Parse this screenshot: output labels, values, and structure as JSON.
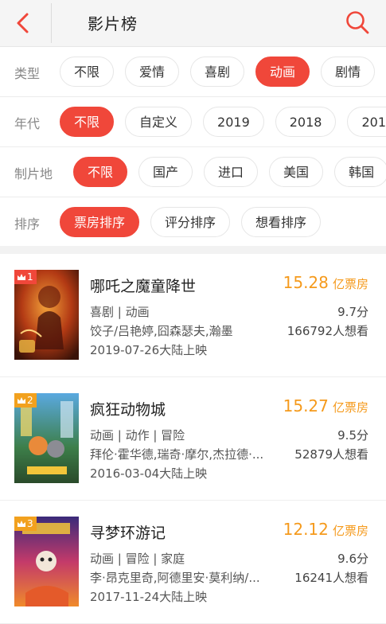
{
  "header": {
    "title": "影片榜",
    "back_icon": "chevron-left-icon",
    "search_icon": "search-icon",
    "accent_color": "#f0473a"
  },
  "filters": [
    {
      "label": "类型",
      "options": [
        "不限",
        "爱情",
        "喜剧",
        "动画",
        "剧情"
      ],
      "selected": "动画"
    },
    {
      "label": "年代",
      "options": [
        "不限",
        "自定义",
        "2019",
        "2018",
        "201"
      ],
      "selected": "不限"
    },
    {
      "label": "制片地",
      "options": [
        "不限",
        "国产",
        "进口",
        "美国",
        "韩国"
      ],
      "selected": "不限"
    },
    {
      "label": "排序",
      "options": [
        "票房排序",
        "评分排序",
        "想看排序"
      ],
      "selected": "票房排序"
    }
  ],
  "movies": [
    {
      "rank": "1",
      "title": "哪吒之魔童降世",
      "genre": "喜剧 | 动画",
      "cast": "饺子/吕艳婷,囧森瑟夫,瀚墨",
      "date": "2019-07-26大陆上映",
      "box_office": "15.28",
      "box_unit": "亿票房",
      "score": "9.7分",
      "want": "166792人想看"
    },
    {
      "rank": "2",
      "title": "疯狂动物城",
      "genre": "动画 | 动作 | 冒险",
      "cast": "拜伦·霍华德,瑞奇·摩尔,杰拉德·...",
      "date": "2016-03-04大陆上映",
      "box_office": "15.27",
      "box_unit": "亿票房",
      "score": "9.5分",
      "want": "52879人想看"
    },
    {
      "rank": "3",
      "title": "寻梦环游记",
      "genre": "动画 | 冒险 | 家庭",
      "cast": "李·昂克里奇,阿德里安·莫利纳/...",
      "date": "2017-11-24大陆上映",
      "box_office": "12.12",
      "box_unit": "亿票房",
      "score": "9.6分",
      "want": "16241人想看"
    }
  ]
}
